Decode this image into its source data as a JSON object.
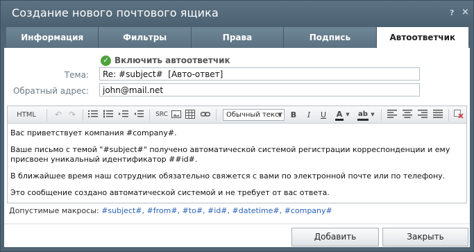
{
  "window": {
    "title": "Создание нового почтового ящика",
    "help_label": "?",
    "close_label": "×"
  },
  "tabs": [
    {
      "label": "Информация",
      "active": false
    },
    {
      "label": "Фильтры",
      "active": false
    },
    {
      "label": "Права",
      "active": false
    },
    {
      "label": "Подпись",
      "active": false
    },
    {
      "label": "Автоответчик",
      "active": true
    }
  ],
  "autoresponder": {
    "enable_label": "Включить автоответчик",
    "enabled": true,
    "subject_label": "Тема:",
    "subject_value": "Re: #subject#  [Авто-ответ]",
    "reply_to_label": "Обратный адрес:",
    "reply_to_value": "john@mail.net"
  },
  "toolbar": {
    "html_label": "HTML",
    "undo_icon": "↶",
    "redo_icon": "↷",
    "src_label": "SRC",
    "format_value": "Обычный текст",
    "format_arrow": "▼",
    "bold": "B",
    "italic": "I",
    "underline": "U",
    "font_color": "A",
    "highlight": "ab"
  },
  "body": {
    "p1": "Вас приветствует компания #company#.",
    "p2": "Ваше письмо с темой \"#subject#\" получено автоматической системой регистрации корреспонденции и ему присвоен уникальный идентификатор ##id#.",
    "p3": "В ближайшее время наш сотрудник обязательно свяжется с вами по электронной почте или по телефону.",
    "p4": "Это сообщение создано автоматической системой и не требует от вас ответа."
  },
  "macros": {
    "label": "Допустимые макросы:",
    "items": [
      "#subject#,",
      "#from#,",
      "#to#,",
      "#id#,",
      "#datetime#,",
      "#company#"
    ]
  },
  "buttons": {
    "add": "Добавить",
    "close": "Закрыть"
  },
  "colors": {
    "header": "#4f6474",
    "tab": "#6f8696",
    "accent": "#2a62b7",
    "check": "#4ea33d"
  }
}
